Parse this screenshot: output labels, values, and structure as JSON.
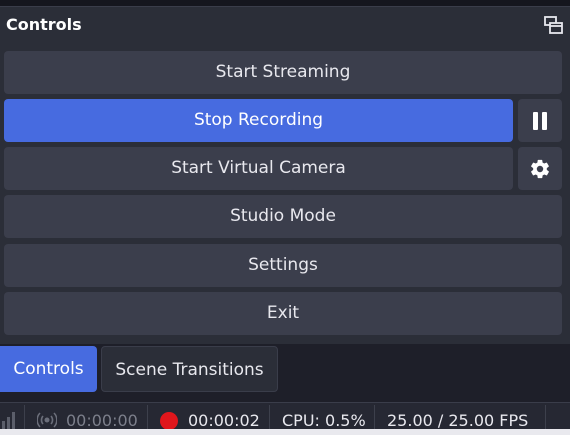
{
  "dock": {
    "title": "Controls",
    "float_icon": "float-window-icon"
  },
  "buttons": {
    "start_streaming": "Start Streaming",
    "stop_recording": "Stop Recording",
    "start_virtual_camera": "Start Virtual Camera",
    "studio_mode": "Studio Mode",
    "settings": "Settings",
    "exit": "Exit"
  },
  "icons": {
    "pause": "pause-icon",
    "gear": "gear-icon",
    "signal": "signal-bars-icon",
    "stream": "broadcast-icon",
    "record": "record-dot-icon"
  },
  "tabs": [
    {
      "label": "Controls",
      "active": true
    },
    {
      "label": "Scene Transitions",
      "active": false
    }
  ],
  "status": {
    "stream_time": "00:00:00",
    "record_time": "00:00:02",
    "cpu": "CPU: 0.5%",
    "fps": "25.00 / 25.00 FPS"
  },
  "colors": {
    "accent": "#476be0",
    "record": "#e0161c",
    "panel": "#2b2e38",
    "button": "#3b3e4c"
  }
}
